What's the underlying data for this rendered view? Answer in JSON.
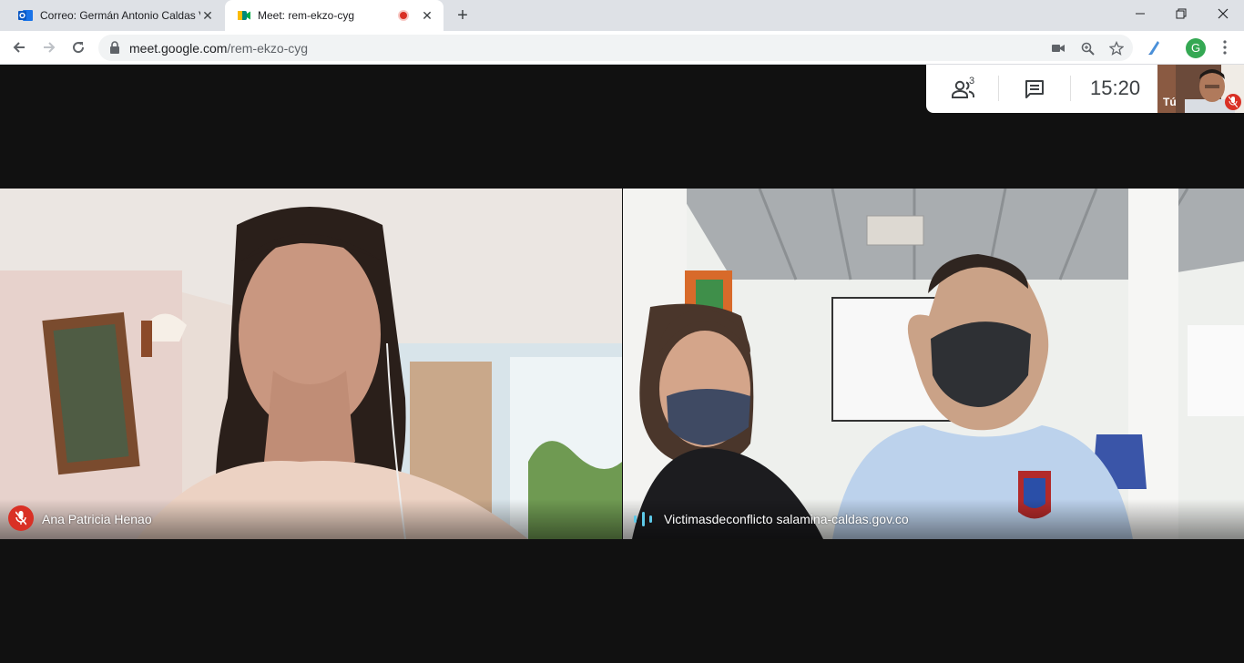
{
  "browser": {
    "tabs": [
      {
        "title": "Correo: Germán Antonio Caldas V",
        "icon": "outlook-icon",
        "active": false
      },
      {
        "title": "Meet: rem-ekzo-cyg",
        "icon": "meet-icon",
        "active": true,
        "recording": true
      }
    ],
    "url_host": "meet.google.com",
    "url_path": "/rem-ekzo-cyg",
    "profile_initial": "G"
  },
  "meet": {
    "participants_count": "3",
    "clock": "15:20",
    "self_label": "Tú",
    "tiles": [
      {
        "name": "Ana Patricia Henao",
        "muted": true
      },
      {
        "name": "Victimasdeconflicto salamina-caldas.gov.co",
        "speaking": true
      }
    ],
    "colors": {
      "mute_red": "#d93025",
      "speaking_blue": "#5dc9e8",
      "background": "#111111"
    }
  }
}
